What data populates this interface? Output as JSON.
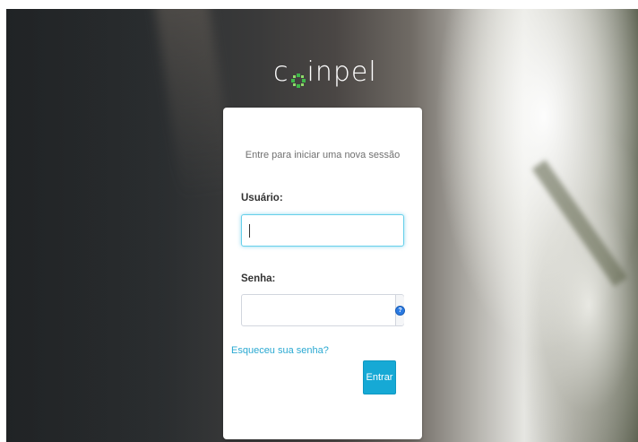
{
  "brand": {
    "logo_prefix": "c",
    "logo_suffix": "inpel",
    "logo_mark_icon": "pinwheel-logo-mark-icon",
    "accent_color": "#3fb84a"
  },
  "login": {
    "subtitle": "Entre para iniciar uma nova sessão",
    "username_label": "Usuário:",
    "username_value": "",
    "password_label": "Senha:",
    "password_value": "",
    "help_icon": "question-circle-icon",
    "forgot_link": "Esqueceu sua senha?",
    "submit_label": "Entrar",
    "button_color": "#16a9d5",
    "link_color": "#2aa9d2"
  }
}
